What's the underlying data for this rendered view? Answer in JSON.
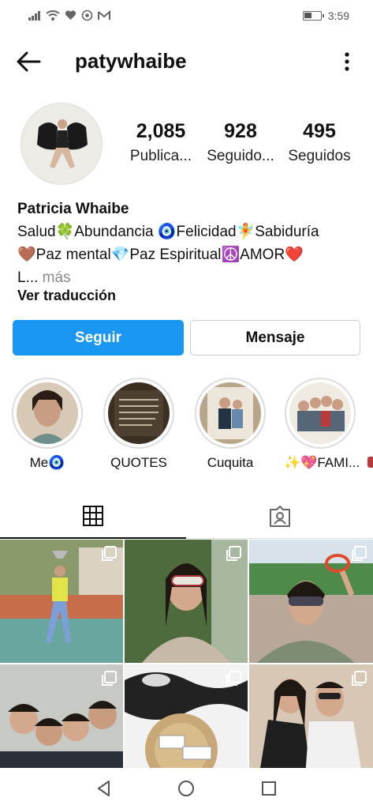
{
  "status_bar": {
    "time": "3:59"
  },
  "header": {
    "username": "patywhaibe"
  },
  "stats": [
    {
      "value": "2,085",
      "label": "Publica..."
    },
    {
      "value": "928",
      "label": "Seguido..."
    },
    {
      "value": "495",
      "label": "Seguidos"
    }
  ],
  "bio": {
    "name": "Patricia Whaibe",
    "line1": "Salud🍀Abundancia 🧿Felicidad🧚Sabiduría",
    "line2": "🤎Paz mental💎Paz Espiritual☮️AMOR❤️",
    "line3_start": "L...",
    "more": " más",
    "translate": "Ver traducción"
  },
  "buttons": {
    "follow": "Seguir",
    "message": "Mensaje"
  },
  "highlights": [
    {
      "label": "Me🧿"
    },
    {
      "label": "QUOTES"
    },
    {
      "label": "Cuquita"
    },
    {
      "label": "✨💖FAMI..."
    }
  ],
  "colors": {
    "follow_button": "#1a97f3",
    "accent": "#1a97f3"
  }
}
